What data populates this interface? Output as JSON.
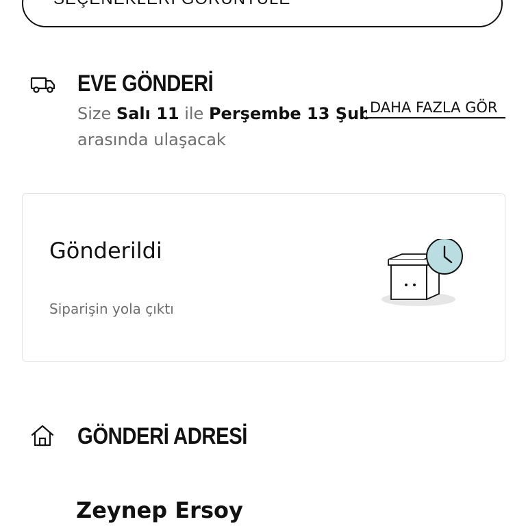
{
  "options": {
    "label": "SEÇENEKLERİ GÖRÜNTÜLE",
    "chevron_icon": "chevron-down-icon"
  },
  "shipping": {
    "icon": "truck-icon",
    "title": "EVE GÖNDERİ",
    "text_prefix": "Size ",
    "date_start": "Salı 11",
    "text_middle": " ile ",
    "date_end": "Perşembe 13 Şub",
    "text_suffix": "arasında ulaşacak",
    "see_more_label": "DAHA FAZLA GÖR"
  },
  "status": {
    "title": "Gönderildi",
    "subtitle": "Siparişin yola çıktı",
    "illustration_icon": "box-clock-icon",
    "accent_color": "#b9dde0"
  },
  "address": {
    "icon": "home-icon",
    "title": "GÖNDERİ ADRESİ",
    "recipient_name": "Zeynep Ersoy"
  }
}
